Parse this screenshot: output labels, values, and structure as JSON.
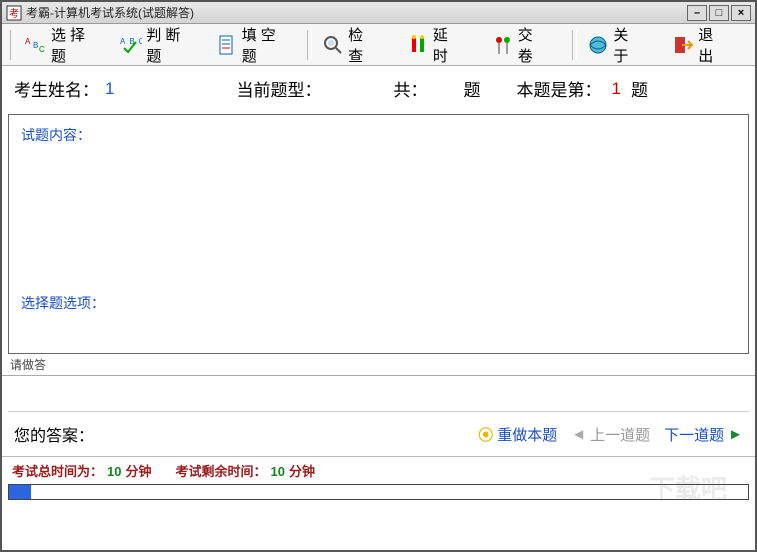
{
  "title": "考霸-计算机考试系统(试题解答)",
  "toolbar": {
    "choice": "选择题",
    "judge": "判断题",
    "fill": "填空题",
    "check": "检 查",
    "delay": "延 时",
    "submit": "交 卷",
    "about": "关 于",
    "exit": "退 出"
  },
  "info": {
    "name_label": "考生姓名：",
    "name_value": "1",
    "type_label": "当前题型：",
    "total_label": "共：",
    "total_unit": "题",
    "current_label": "本题是第：",
    "current_value": "1",
    "current_unit": "题"
  },
  "question": {
    "content_label": "试题内容：",
    "options_label": "选择题选项："
  },
  "instruct": "请做答",
  "answer": {
    "label": "您的答案：",
    "redo": "重做本题",
    "prev": "上一道题",
    "next": "下一道题"
  },
  "status": {
    "total_prefix": "考试总时间为：",
    "total_value": "10",
    "total_unit": "分钟",
    "remain_prefix": "考试剩余时间：",
    "remain_value": "10",
    "remain_unit": "分钟"
  },
  "watermark": "下载吧"
}
